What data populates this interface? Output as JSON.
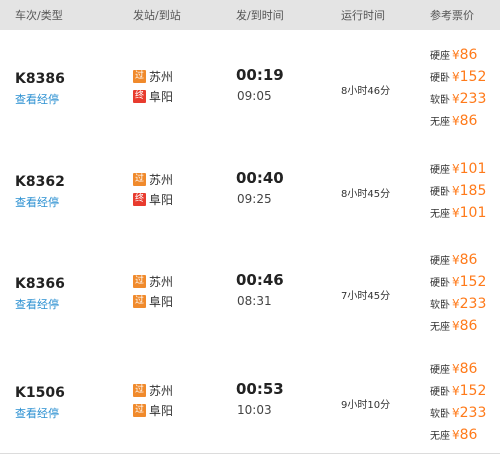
{
  "header": {
    "train": "车次/类型",
    "stations": "发站/到站",
    "times": "发/到时间",
    "duration": "运行时间",
    "price": "参考票价"
  },
  "stops_link_label": "查看经停",
  "currency": "¥",
  "colors": {
    "price": "#ff7a1a",
    "link": "#2a8fd1",
    "badge_pass": "#f08a2c",
    "badge_end": "#e83b2e"
  },
  "trains": [
    {
      "number": "K8386",
      "from": {
        "badge": "过",
        "badge_type": "pass",
        "name": "苏州"
      },
      "to": {
        "badge": "终",
        "badge_type": "end",
        "name": "阜阳"
      },
      "depart": "00:19",
      "arrive": "09:05",
      "duration": "8小时46分",
      "prices": [
        {
          "seat": "硬座",
          "amount": "86"
        },
        {
          "seat": "硬卧",
          "amount": "152"
        },
        {
          "seat": "软卧",
          "amount": "233"
        },
        {
          "seat": "无座",
          "amount": "86"
        }
      ]
    },
    {
      "number": "K8362",
      "from": {
        "badge": "过",
        "badge_type": "pass",
        "name": "苏州"
      },
      "to": {
        "badge": "终",
        "badge_type": "end",
        "name": "阜阳"
      },
      "depart": "00:40",
      "arrive": "09:25",
      "duration": "8小时45分",
      "prices": [
        {
          "seat": "硬座",
          "amount": "101"
        },
        {
          "seat": "硬卧",
          "amount": "185"
        },
        {
          "seat": "无座",
          "amount": "101"
        }
      ]
    },
    {
      "number": "K8366",
      "from": {
        "badge": "过",
        "badge_type": "pass",
        "name": "苏州"
      },
      "to": {
        "badge": "过",
        "badge_type": "pass",
        "name": "阜阳"
      },
      "depart": "00:46",
      "arrive": "08:31",
      "duration": "7小时45分",
      "prices": [
        {
          "seat": "硬座",
          "amount": "86"
        },
        {
          "seat": "硬卧",
          "amount": "152"
        },
        {
          "seat": "软卧",
          "amount": "233"
        },
        {
          "seat": "无座",
          "amount": "86"
        }
      ]
    },
    {
      "number": "K1506",
      "from": {
        "badge": "过",
        "badge_type": "pass",
        "name": "苏州"
      },
      "to": {
        "badge": "过",
        "badge_type": "pass",
        "name": "阜阳"
      },
      "depart": "00:53",
      "arrive": "10:03",
      "duration": "9小时10分",
      "prices": [
        {
          "seat": "硬座",
          "amount": "86"
        },
        {
          "seat": "硬卧",
          "amount": "152"
        },
        {
          "seat": "软卧",
          "amount": "233"
        },
        {
          "seat": "无座",
          "amount": "86"
        }
      ]
    }
  ]
}
